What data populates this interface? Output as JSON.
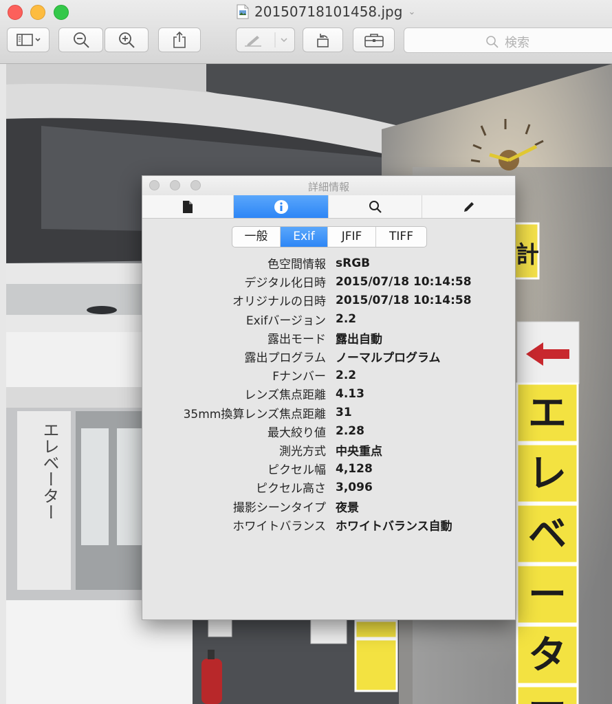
{
  "window": {
    "title": "20150718101458.jpg"
  },
  "toolbar": {
    "sidebar_button": "sidebar-toggle",
    "zoom_out": "zoom-out",
    "zoom_in": "zoom-in",
    "share": "share",
    "markup": "markup",
    "rotate": "rotate-left",
    "toolbox": "toolbox",
    "search_placeholder": "検索"
  },
  "inspector": {
    "title": "詳細情報",
    "tabs": [
      "document-info",
      "more-info",
      "keywords",
      "annotations"
    ],
    "active_tab_index": 1,
    "subtabs": [
      "一般",
      "Exif",
      "JFIF",
      "TIFF"
    ],
    "active_subtab_index": 1,
    "rows": [
      {
        "key": "色空間情報",
        "value": "sRGB"
      },
      {
        "key": "デジタル化日時",
        "value": "2015/07/18 10:14:58"
      },
      {
        "key": "オリジナルの日時",
        "value": "2015/07/18 10:14:58"
      },
      {
        "key": "Exifバージョン",
        "value": "2.2"
      },
      {
        "key": "露出モード",
        "value": "露出自動"
      },
      {
        "key": "露出プログラム",
        "value": "ノーマルプログラム"
      },
      {
        "key": "Fナンバー",
        "value": "2.2"
      },
      {
        "key": "レンズ焦点距離",
        "value": "4.13"
      },
      {
        "key": "35mm換算レンズ焦点距離",
        "value": "31"
      },
      {
        "key": "最大絞り値",
        "value": "2.28"
      },
      {
        "key": "測光方式",
        "value": "中央重点"
      },
      {
        "key": "ピクセル幅",
        "value": "4,128"
      },
      {
        "key": "ピクセル高さ",
        "value": "3,096"
      },
      {
        "key": "撮影シーンタイプ",
        "value": "夜景"
      },
      {
        "key": "ホワイトバランス",
        "value": "ホワイトバランス自動"
      }
    ]
  },
  "photo": {
    "sign_vertical": "エレベーター",
    "sign_right": [
      "エ",
      "レ",
      "ベ",
      "ー",
      "タ",
      "ー"
    ],
    "sign_partial": "計"
  },
  "colors": {
    "accent_blue": "#2d86f6",
    "close": "#fc605b",
    "minimize": "#fdbc40",
    "maximize": "#34c84a",
    "sign_yellow": "#f3e241"
  }
}
